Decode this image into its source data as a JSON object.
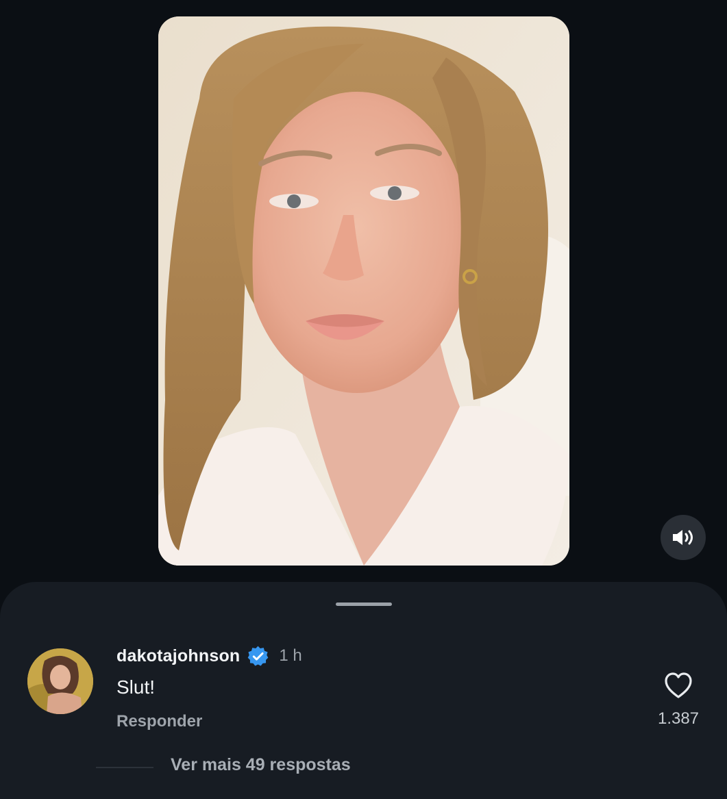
{
  "video": {
    "mute_icon": "speaker-sound-icon"
  },
  "comment": {
    "username": "dakotajohnson",
    "verified_icon": "verified-badge-icon",
    "time": "1 h",
    "text": "Slut!",
    "reply_label": "Responder",
    "like_icon": "heart-outline-icon",
    "like_count": "1.387",
    "view_replies_label": "Ver mais 49 respostas"
  },
  "colors": {
    "background": "#0b0f14",
    "sheet": "#171c23",
    "verified_blue": "#3797f0",
    "secondary_text": "#9ea4ab"
  }
}
